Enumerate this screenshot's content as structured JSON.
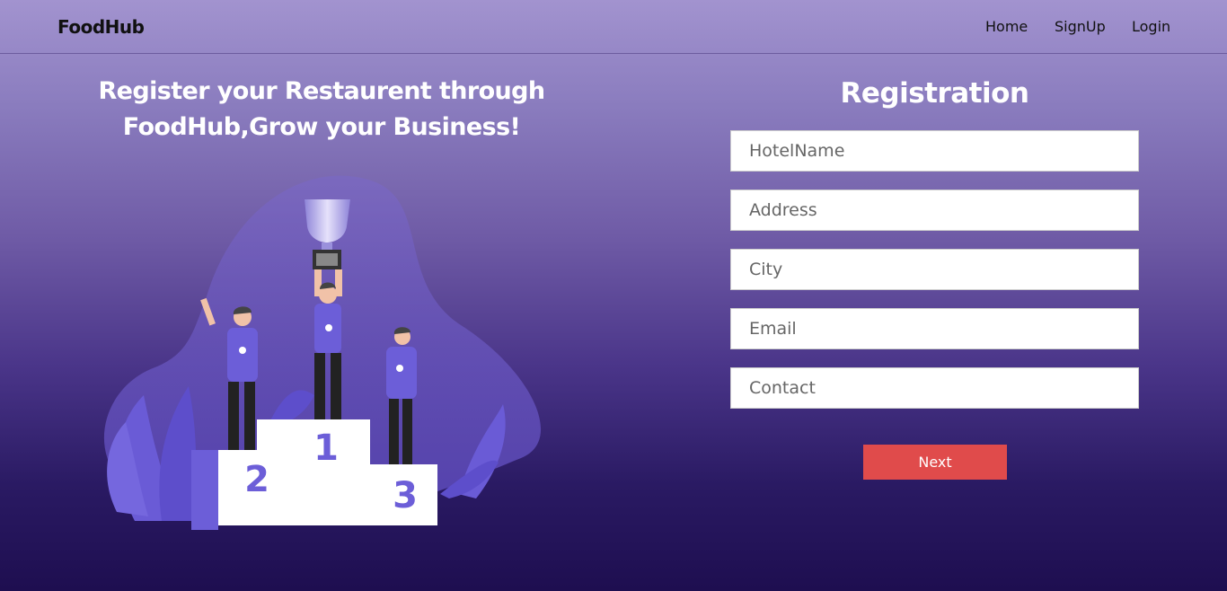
{
  "nav": {
    "brand": "FoodHub",
    "links": [
      "Home",
      "SignUp",
      "Login"
    ]
  },
  "hero": {
    "line1": "Register your Restaurent through",
    "line2": "FoodHub,Grow your Business!",
    "podium_labels": [
      "1",
      "2",
      "3"
    ]
  },
  "form": {
    "title": "Registration",
    "fields": [
      {
        "placeholder": "HotelName",
        "value": ""
      },
      {
        "placeholder": "Address",
        "value": ""
      },
      {
        "placeholder": "City",
        "value": ""
      },
      {
        "placeholder": "Email",
        "value": ""
      },
      {
        "placeholder": "Contact",
        "value": ""
      }
    ],
    "submit_label": "Next"
  },
  "colors": {
    "accent": "#e04b4b",
    "illustration_purple": "#6c5ed8"
  }
}
